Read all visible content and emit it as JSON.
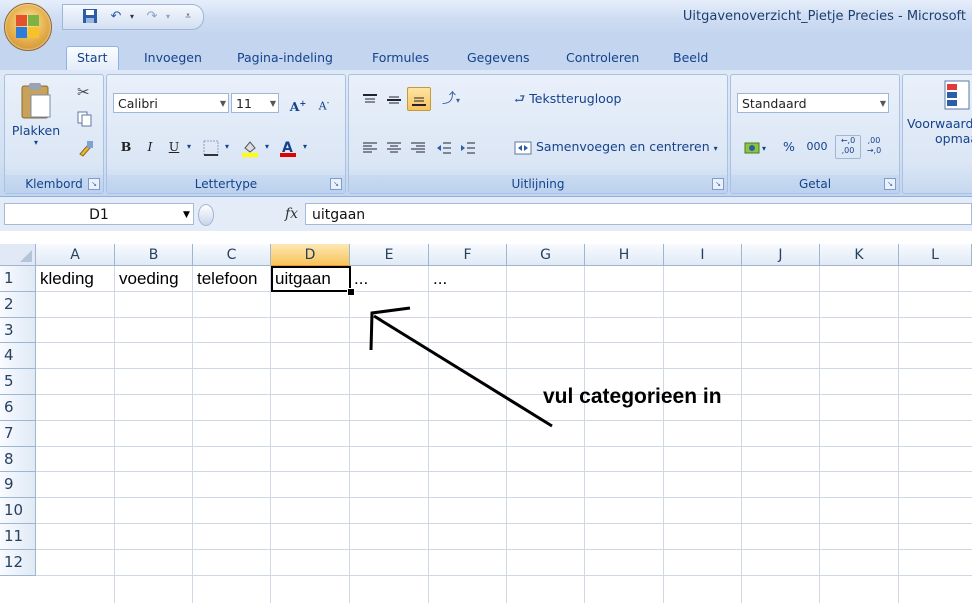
{
  "window": {
    "title": "Uitgavenoverzicht_Pietje Precies - Microsoft"
  },
  "tabs": [
    "Start",
    "Invoegen",
    "Pagina-indeling",
    "Formules",
    "Gegevens",
    "Controleren",
    "Beeld"
  ],
  "active_tab": "Start",
  "ribbon": {
    "clipboard": {
      "label": "Klembord",
      "paste_label": "Plakken"
    },
    "font": {
      "label": "Lettertype",
      "font_name": "Calibri",
      "font_size": "11"
    },
    "alignment": {
      "label": "Uitlijning",
      "wrap_text": "Tekstterugloop",
      "merge_center": "Samenvoegen en centreren"
    },
    "number": {
      "label": "Getal",
      "format": "Standaard",
      "percent": "%",
      "thousands": "000"
    },
    "styles": {
      "conditional_line1": "Voorwaard",
      "conditional_line2": "opmaa"
    }
  },
  "formula_bar": {
    "name_box": "D1",
    "fx": "fx",
    "value": "uitgaan"
  },
  "sheet": {
    "columns": [
      "A",
      "B",
      "C",
      "D",
      "E",
      "F",
      "G",
      "H",
      "I",
      "J",
      "K",
      "L"
    ],
    "rows": [
      "1",
      "2",
      "3",
      "4",
      "5",
      "6",
      "7",
      "8",
      "9",
      "10",
      "11",
      "12"
    ],
    "selected_column": "D",
    "row1": [
      "kleding",
      "voeding",
      "telefoon",
      "uitgaan",
      "...",
      "..."
    ]
  },
  "annotation": "vul categorieen in",
  "colors": {
    "accent": "#15428b",
    "selected_header": "#f8c35a",
    "gridline": "#d0d7e5"
  }
}
